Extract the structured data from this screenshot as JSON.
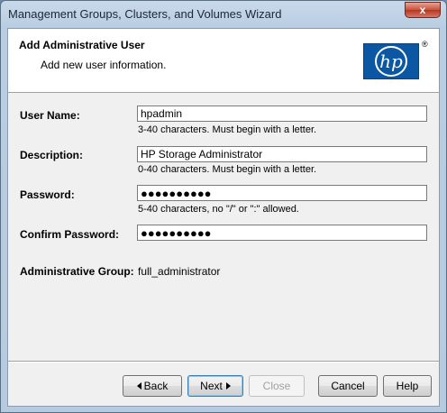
{
  "window": {
    "title": "Management Groups, Clusters, and Volumes Wizard",
    "close_glyph": "x"
  },
  "header": {
    "title": "Add Administrative User",
    "subtitle": "Add new user information.",
    "logo_icon": "hp-logo"
  },
  "form": {
    "username": {
      "label": "User Name:",
      "value": "hpadmin",
      "hint": "3-40 characters. Must begin with a letter."
    },
    "description": {
      "label": "Description:",
      "value": "HP Storage Administrator",
      "hint": "0-40 characters. Must begin with a letter."
    },
    "password": {
      "label": "Password:",
      "value": "●●●●●●●●●●",
      "hint": "5-40 characters, no \"/\" or \":\" allowed."
    },
    "confirm_password": {
      "label": "Confirm Password:",
      "value": "●●●●●●●●●●"
    },
    "admin_group": {
      "label": "Administrative Group:",
      "value": "full_administrator"
    }
  },
  "buttons": {
    "back": "Back",
    "next": "Next",
    "close": "Close",
    "cancel": "Cancel",
    "help": "Help"
  },
  "colors": {
    "hp_blue": "#0b57a3",
    "title_bar": "#c9d9ea",
    "close_red": "#c8503a"
  }
}
